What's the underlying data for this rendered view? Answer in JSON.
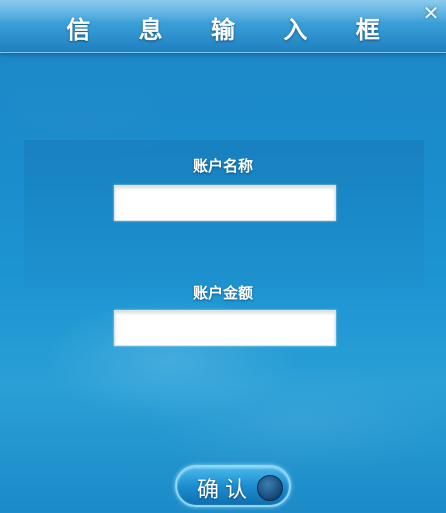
{
  "dialog": {
    "title": "信 息 输 入 框",
    "close_symbol": "✕"
  },
  "form": {
    "account_name_label": "账户名称",
    "account_name_value": "",
    "account_amount_label": "账户金额",
    "account_amount_value": ""
  },
  "actions": {
    "confirm_label": "确认",
    "confirm_icon": "circle-icon"
  },
  "colors": {
    "background": "#1d95d2",
    "title_bar": "#3a9fd8",
    "text": "#ffffff"
  }
}
